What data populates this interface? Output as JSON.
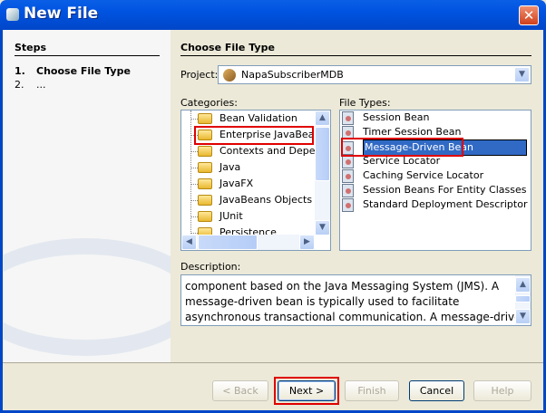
{
  "window": {
    "title": "New File",
    "close": "✕"
  },
  "steps": {
    "heading": "Steps",
    "items": [
      {
        "num": "1.",
        "label": "Choose File Type"
      },
      {
        "num": "2.",
        "label": "..."
      }
    ]
  },
  "main": {
    "heading": "Choose File Type",
    "project_label": "Project:",
    "project_value": "NapaSubscriberMDB",
    "categories_label": "Categories:",
    "categories": [
      "Bean Validation",
      "Enterprise JavaBean",
      "Contexts and Depen",
      "Java",
      "JavaFX",
      "JavaBeans Objects",
      "JUnit",
      "Persistence"
    ],
    "file_types_label": "File Types:",
    "file_types": [
      "Session Bean",
      "Timer Session Bean",
      "Message-Driven Bean",
      "Service Locator",
      "Caching Service Locator",
      "Session Beans For Entity Classes",
      "Standard Deployment Descriptor"
    ],
    "description_label": "Description:",
    "description_lines": [
      "component based on the Java Messaging System (JMS). A",
      "message-driven bean is typically used to facilitate",
      "asynchronous transactional communication. A message-driven"
    ]
  },
  "buttons": {
    "back": "< Back",
    "next": "Next >",
    "finish": "Finish",
    "cancel": "Cancel",
    "help": "Help"
  }
}
